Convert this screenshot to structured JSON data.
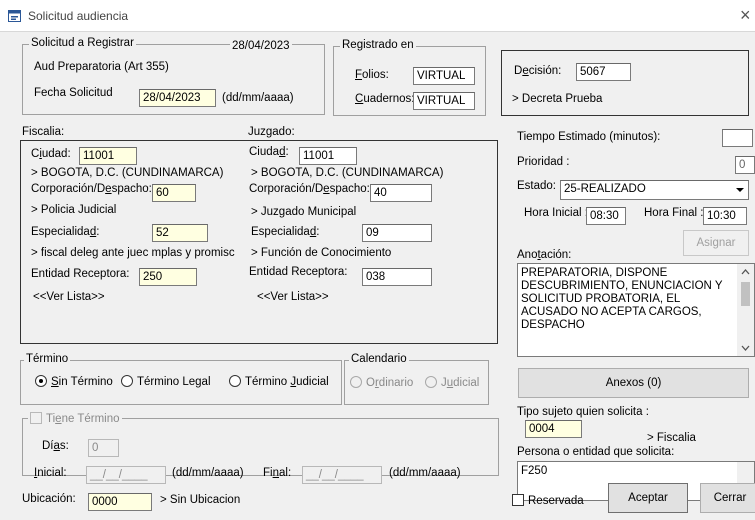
{
  "window": {
    "title": "Solicitud audiencia",
    "close_glyph": "×"
  },
  "solicitud": {
    "group_title": "Solicitud a Registrar",
    "date": "28/04/2023",
    "type": "Aud Preparatoria (Art 355)",
    "fecha_label": "Fecha Solicitud",
    "fecha_value": "28/04/2023",
    "fecha_fmt": "(dd/mm/aaaa)"
  },
  "registrado": {
    "group_title": "Registrado en",
    "folios_label": "Folios:",
    "folios_value": "VIRTUAL",
    "cuadernos_label": "Cuadernos:",
    "cuadernos_value": "VIRTUAL"
  },
  "decision": {
    "label": "Decisión:",
    "value": "5067",
    "desc": "> Decreta Prueba"
  },
  "fiscalia": {
    "header": "Fiscalia:",
    "ciudad_label": "Ciudad:",
    "ciudad_value": "11001",
    "ciudad_desc": "> BOGOTA, D.C. (CUNDINAMARCA)",
    "corp_label": "Corporación/Despacho:",
    "corp_value": "60",
    "corp_desc": "> Policia Judicial",
    "esp_label": "Especialidad:",
    "esp_value": "52",
    "esp_desc": "> fiscal deleg ante juec mplas y promisc",
    "ent_label": "Entidad Receptora:",
    "ent_value": "250",
    "ver_lista": "<<Ver Lista>>"
  },
  "juzgado": {
    "header": "Juzgado:",
    "ciudad_label": "Ciudad:",
    "ciudad_value": "11001",
    "ciudad_desc": "> BOGOTA, D.C. (CUNDINAMARCA)",
    "corp_label": "Corporación/Despacho:",
    "corp_value": "40",
    "corp_desc": "> Juzgado Municipal",
    "esp_label": "Especialidad:",
    "esp_value": "09",
    "esp_desc": "> Función de Conocimiento",
    "ent_label": "Entidad Receptora:",
    "ent_value": "038",
    "ver_lista": "<<Ver Lista>>"
  },
  "right": {
    "tiempo_label": "Tiempo Estimado (minutos):",
    "tiempo_value": "",
    "prioridad_label": "Prioridad :",
    "prioridad_value": "0",
    "estado_label": "Estado:",
    "estado_value": "25-REALIZADO",
    "hora_ini_label": "Hora Inicial :",
    "hora_ini_value": "08:30",
    "hora_fin_label": "Hora Final :",
    "hora_fin_value": "10:30",
    "asignar_label": "Asignar",
    "anotacion_label": "Anotación:",
    "anotacion_text": "PREPARATORIA, DISPONE DESCUBRIMIENTO, ENUNCIACION Y SOLICITUD PROBATORIA, EL ACUSADO NO ACEPTA CARGOS, DESPACHO",
    "anexos_label": "Anexos (0)",
    "tipo_label": "Tipo sujeto quien solicita :",
    "tipo_value": "0004",
    "tipo_desc": "> Fiscalia",
    "persona_label": "Persona o entidad que solicita:",
    "persona_value": "F250"
  },
  "termino": {
    "group_title": "Término",
    "sin": "Sin Término",
    "legal": "Término Legal",
    "judicial": "Término Judicial"
  },
  "calendario": {
    "group_title": "Calendario",
    "ordinario": "Ordinario",
    "judicial": "Judicial"
  },
  "tiene": {
    "label": "Tiene Término",
    "dias_label": "Días:",
    "dias_value": "0",
    "inicial_label": "Inicial:",
    "inicial_value": "__/__/____",
    "inicial_fmt": "(dd/mm/aaaa)",
    "final_label": "Final:",
    "final_value": "__/__/____",
    "final_fmt": "(dd/mm/aaaa)"
  },
  "bottom": {
    "ubicacion_label": "Ubicación:",
    "ubicacion_value": "0000",
    "ubicacion_desc": "> Sin Ubicacion",
    "reservada_label": "Reservada",
    "aceptar_label": "Aceptar",
    "cerrar_label": "Cerrar"
  },
  "colors": {
    "field_yellow": "#ffffe1",
    "window_bg": "#f0f0f0",
    "icon_blue": "#2b5797"
  }
}
